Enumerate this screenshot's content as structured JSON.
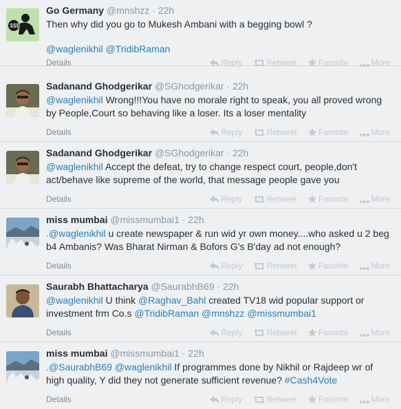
{
  "actions": {
    "reply": "Reply",
    "retweet": "Retweet",
    "favorite": "Favorite",
    "more": "More",
    "details": "Details"
  },
  "tweets": [
    {
      "name": "Go Germany",
      "handle": "@mnshzz",
      "time": "22h",
      "text": "Then why did you go to Mukesh Ambani with a begging bowl ?",
      "mentions": "@waglenikhil @TridibRaman",
      "avatar": "baby-silhouette"
    },
    {
      "name": "Sadanand Ghodgerikar",
      "handle": "@SGhodgerikar",
      "time": "22h",
      "mention": "@waglenikhil",
      "text": "Wrong!!!You have no morale right to speak, you all proved wrong by People,Court so behaving like a loser. Its a loser mentality",
      "avatar": "man-portrait"
    },
    {
      "name": "Sadanand Ghodgerikar",
      "handle": "@SGhodgerikar",
      "time": "22h",
      "mention": "@waglenikhil",
      "text": "Accept the defeat, try to change respect court, people,don't act/behave like supreme of the world, that message people gave you",
      "avatar": "man-portrait"
    },
    {
      "name": "miss mumbai",
      "handle": "@missmumbai1",
      "time": "22h",
      "mention": ".@waglenikhil",
      "text": "u create newspaper & run wid yr own money....who asked u 2 beg b4 Ambanis? Was Bharat Nirman & Bofors G's B'day ad not enough?",
      "avatar": "landscape-photo"
    },
    {
      "name": "Saurabh Bhattacharya",
      "handle": "@SaurabhB69",
      "time": "22h",
      "parts": [
        "@waglenikhil",
        " U think ",
        "@Raghav_Bahl",
        " created TV18 wid popular support or investment frm Co.s ",
        "@TridibRaman",
        " ",
        "@mnshzz",
        " ",
        "@missmumbai1"
      ],
      "avatar": "man-portrait-2"
    },
    {
      "name": "miss mumbai",
      "handle": "@missmumbai1",
      "time": "22h",
      "parts": [
        ".@SaurabhB69",
        " ",
        "@waglenikhil",
        " If programmes done by Nikhil or Rajdeep wr of high quality, Y did they not generate sufficient revenue? ",
        "#Cash4Vote"
      ],
      "avatar": "landscape-photo"
    }
  ]
}
